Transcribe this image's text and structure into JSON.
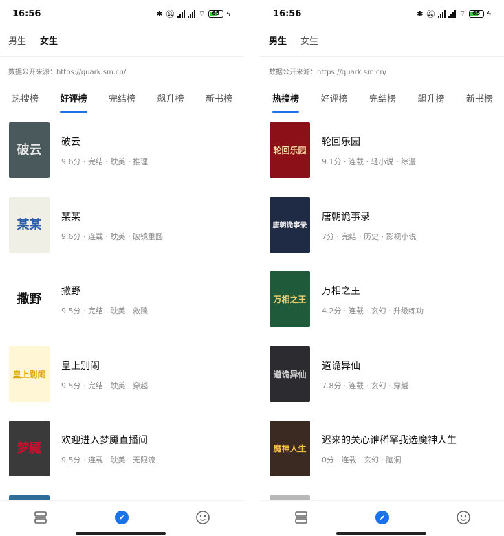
{
  "status": {
    "time": "16:56",
    "battery": "65",
    "battery_fraction": 0.65
  },
  "panels": [
    {
      "gender": [
        "男生",
        "女生"
      ],
      "active_gender": 1,
      "source": "数据公开来源：https://quark.sm.cn/",
      "tabs": [
        "热搜榜",
        "好评榜",
        "完结榜",
        "飙升榜",
        "新书榜"
      ],
      "active_tab": 1,
      "books": [
        {
          "title": "破云",
          "meta": "9.6分 · 完结 · 耽美 · 推理",
          "cover_text": "破云",
          "cover_bg": "#4a5a5c",
          "cover_fg": "#e8e8e8"
        },
        {
          "title": "某某",
          "meta": "9.6分 · 连载 · 耽美 · 破镜重圆",
          "cover_text": "某某",
          "cover_bg": "#f0efe6",
          "cover_fg": "#2a5fa8"
        },
        {
          "title": "撒野",
          "meta": "9.5分 · 完结 · 耽美 · 救赎",
          "cover_text": "撒野",
          "cover_bg": "#ffffff",
          "cover_fg": "#111111"
        },
        {
          "title": "皇上别闹",
          "meta": "9.5分 · 完结 · 耽美 · 穿越",
          "cover_text": "皇上别闹",
          "cover_bg": "#fff6d6",
          "cover_fg": "#e0a600"
        },
        {
          "title": "欢迎进入梦魇直播间",
          "meta": "9.5分 · 连载 · 耽美 · 无限流",
          "cover_text": "梦魇",
          "cover_bg": "#3a3a3a",
          "cover_fg": "#c8102e"
        }
      ],
      "peek_color": "#2d6f9a"
    },
    {
      "gender": [
        "男生",
        "女生"
      ],
      "active_gender": 0,
      "source": "数据公开来源：https://quark.sm.cn/",
      "tabs": [
        "热搜榜",
        "好评榜",
        "完结榜",
        "飙升榜",
        "新书榜"
      ],
      "active_tab": 0,
      "books": [
        {
          "title": "轮回乐园",
          "meta": "9.1分 · 连载 · 轻小说 · 综漫",
          "cover_text": "轮回乐园",
          "cover_bg": "#8b1018",
          "cover_fg": "#f5d9a0"
        },
        {
          "title": "唐朝诡事录",
          "meta": "7分 · 完结 · 历史 · 影视小说",
          "cover_text": "唐朝诡事录",
          "cover_bg": "#1f2a44",
          "cover_fg": "#e8e8e8"
        },
        {
          "title": "万相之王",
          "meta": "4.2分 · 连载 · 玄幻 · 升级练功",
          "cover_text": "万相之王",
          "cover_bg": "#1f5a3a",
          "cover_fg": "#f0d070"
        },
        {
          "title": "道诡异仙",
          "meta": "7.8分 · 连载 · 玄幻 · 穿越",
          "cover_text": "道诡异仙",
          "cover_bg": "#2c2c30",
          "cover_fg": "#d0d0d0"
        },
        {
          "title": "迟来的关心谁稀罕我选魔神人生",
          "meta": "0分 · 连载 · 玄幻 · 脑洞",
          "cover_text": "魔神人生",
          "cover_bg": "#3a2a22",
          "cover_fg": "#f5c040"
        }
      ],
      "peek_color": "#b8b8b8"
    }
  ],
  "accent": "#1a73e8",
  "nav_icons": [
    "bookshelf-icon",
    "compass-icon",
    "smiley-icon"
  ]
}
